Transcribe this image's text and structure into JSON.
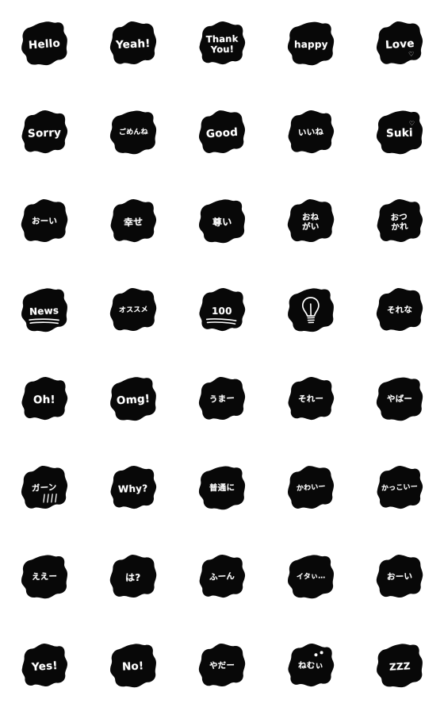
{
  "meta": {
    "title": "Handwritten Black Speech Bubble Sticker Set",
    "background_color": "#ffffff",
    "bubble_color": "#080808",
    "text_color": "#ffffff",
    "columns": 5,
    "rows": 8,
    "total_stickers": 40
  },
  "stickers": [
    {
      "id": "s01",
      "text": "Hello",
      "size": "sz-lg",
      "deco": "none",
      "lang": "en"
    },
    {
      "id": "s02",
      "text": "Yeah!",
      "size": "sz-lg",
      "deco": "none",
      "lang": "en"
    },
    {
      "id": "s03",
      "text": "Thank\nYou!",
      "size": "sz-2l",
      "deco": "none",
      "lang": "en"
    },
    {
      "id": "s04",
      "text": "happy",
      "size": "sz-md",
      "deco": "none",
      "lang": "en"
    },
    {
      "id": "s05",
      "text": "Love",
      "size": "sz-lg",
      "deco": "heart-love",
      "lang": "en"
    },
    {
      "id": "s06",
      "text": "Sorry",
      "size": "sz-lg",
      "deco": "none",
      "lang": "en"
    },
    {
      "id": "s07",
      "text": "ごめんね",
      "size": "sz-xs",
      "deco": "none",
      "lang": "ja"
    },
    {
      "id": "s08",
      "text": "Good",
      "size": "sz-lg",
      "deco": "none",
      "lang": "en"
    },
    {
      "id": "s09",
      "text": "いいね",
      "size": "sz-sm",
      "deco": "none",
      "lang": "ja"
    },
    {
      "id": "s10",
      "text": "Suki",
      "size": "sz-lg",
      "deco": "heart-suki",
      "lang": "en"
    },
    {
      "id": "s11",
      "text": "おーい",
      "size": "sz-sm",
      "deco": "none",
      "lang": "ja"
    },
    {
      "id": "s12",
      "text": "幸せ",
      "size": "sz-md",
      "deco": "none",
      "lang": "ja"
    },
    {
      "id": "s13",
      "text": "尊い",
      "size": "sz-md",
      "deco": "none",
      "lang": "ja"
    },
    {
      "id": "s14",
      "text": "おね\nがい",
      "size": "sz-sm",
      "deco": "none",
      "lang": "ja"
    },
    {
      "id": "s15",
      "text": "おつ\nかれ",
      "size": "sz-sm",
      "deco": "none",
      "lang": "ja"
    },
    {
      "id": "s16",
      "text": "News",
      "size": "sz-md",
      "deco": "underline",
      "lang": "en"
    },
    {
      "id": "s17",
      "text": "オススメ",
      "size": "sz-xs",
      "deco": "none",
      "lang": "ja"
    },
    {
      "id": "s18",
      "text": "100",
      "size": "sz-md",
      "deco": "underline",
      "lang": "en"
    },
    {
      "id": "s19",
      "text": "",
      "size": "sz-md",
      "deco": "bulb",
      "lang": "icon",
      "icon": "lightbulb-icon"
    },
    {
      "id": "s20",
      "text": "それな",
      "size": "sz-sm",
      "deco": "none",
      "lang": "ja"
    },
    {
      "id": "s21",
      "text": "Oh!",
      "size": "sz-lg",
      "deco": "none",
      "lang": "en"
    },
    {
      "id": "s22",
      "text": "Omg!",
      "size": "sz-lg",
      "deco": "none",
      "lang": "en"
    },
    {
      "id": "s23",
      "text": "うまー",
      "size": "sz-sm",
      "deco": "none",
      "lang": "ja"
    },
    {
      "id": "s24",
      "text": "それー",
      "size": "sz-sm",
      "deco": "none",
      "lang": "ja"
    },
    {
      "id": "s25",
      "text": "やばー",
      "size": "sz-sm",
      "deco": "none",
      "lang": "ja"
    },
    {
      "id": "s26",
      "text": "ガーン",
      "size": "sz-sm",
      "deco": "shock",
      "lang": "ja"
    },
    {
      "id": "s27",
      "text": "Why?",
      "size": "sz-md",
      "deco": "none",
      "lang": "en"
    },
    {
      "id": "s28",
      "text": "普通に",
      "size": "sz-sm",
      "deco": "none",
      "lang": "ja"
    },
    {
      "id": "s29",
      "text": "かわいー",
      "size": "sz-xs",
      "deco": "none",
      "lang": "ja"
    },
    {
      "id": "s30",
      "text": "かっこいー",
      "size": "sz-xs",
      "deco": "none",
      "lang": "ja"
    },
    {
      "id": "s31",
      "text": "ええー",
      "size": "sz-sm",
      "deco": "none",
      "lang": "ja"
    },
    {
      "id": "s32",
      "text": "は?",
      "size": "sz-md",
      "deco": "none",
      "lang": "ja"
    },
    {
      "id": "s33",
      "text": "ふーん",
      "size": "sz-sm",
      "deco": "none",
      "lang": "ja"
    },
    {
      "id": "s34",
      "text": "イタぃ…",
      "size": "sz-xs",
      "deco": "none",
      "lang": "ja"
    },
    {
      "id": "s35",
      "text": "おーい",
      "size": "sz-sm",
      "deco": "none",
      "lang": "ja"
    },
    {
      "id": "s36",
      "text": "Yes!",
      "size": "sz-lg",
      "deco": "none",
      "lang": "en"
    },
    {
      "id": "s37",
      "text": "No!",
      "size": "sz-lg",
      "deco": "none",
      "lang": "en"
    },
    {
      "id": "s38",
      "text": "やだー",
      "size": "sz-sm",
      "deco": "none",
      "lang": "ja"
    },
    {
      "id": "s39",
      "text": "ねむぃ",
      "size": "sz-sm",
      "deco": "sleep",
      "lang": "ja"
    },
    {
      "id": "s40",
      "text": "ZZZ",
      "size": "sz-md",
      "deco": "none",
      "lang": "en"
    }
  ]
}
